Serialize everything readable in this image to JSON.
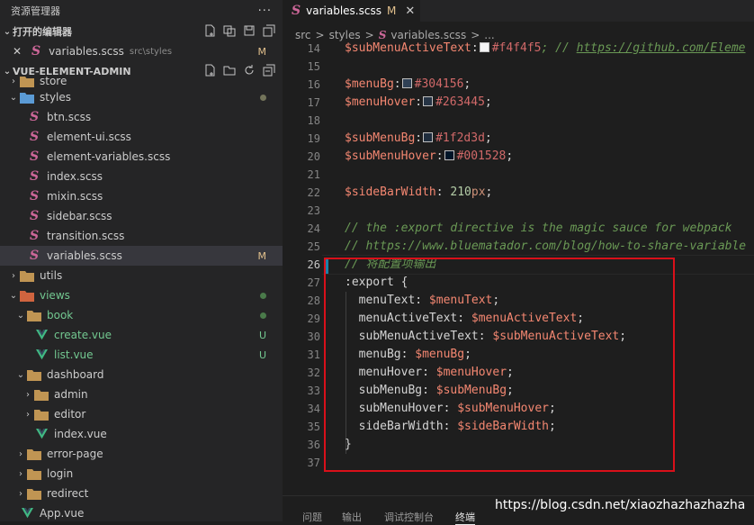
{
  "explorer": {
    "title": "资源管理器",
    "more": "···",
    "open_editors_label": "打开的编辑器",
    "open_file": {
      "close": "✕",
      "name": "variables.scss",
      "path": "src\\styles",
      "status": "M"
    },
    "project_label": "VUE-ELEMENT-ADMIN",
    "tree": [
      {
        "label": "store",
        "depth": 1,
        "type": "folder",
        "partial": true
      },
      {
        "label": "styles",
        "depth": 1,
        "type": "folder-open",
        "dot": true
      },
      {
        "label": "btn.scss",
        "depth": 2,
        "type": "scss"
      },
      {
        "label": "element-ui.scss",
        "depth": 2,
        "type": "scss"
      },
      {
        "label": "element-variables.scss",
        "depth": 2,
        "type": "scss"
      },
      {
        "label": "index.scss",
        "depth": 2,
        "type": "scss"
      },
      {
        "label": "mixin.scss",
        "depth": 2,
        "type": "scss"
      },
      {
        "label": "sidebar.scss",
        "depth": 2,
        "type": "scss"
      },
      {
        "label": "transition.scss",
        "depth": 2,
        "type": "scss"
      },
      {
        "label": "variables.scss",
        "depth": 2,
        "type": "scss",
        "status": "M",
        "selected": true
      },
      {
        "label": "utils",
        "depth": 1,
        "type": "folder"
      },
      {
        "label": "views",
        "depth": 1,
        "type": "folder-open",
        "dot": true,
        "green": true
      },
      {
        "label": "book",
        "depth": 2,
        "type": "folder-open",
        "dot": true,
        "green": true
      },
      {
        "label": "create.vue",
        "depth": 3,
        "type": "vue",
        "status": "U",
        "green": true
      },
      {
        "label": "list.vue",
        "depth": 3,
        "type": "vue",
        "status": "U",
        "green": true
      },
      {
        "label": "dashboard",
        "depth": 2,
        "type": "folder-open"
      },
      {
        "label": "admin",
        "depth": 3,
        "type": "folder"
      },
      {
        "label": "editor",
        "depth": 3,
        "type": "folder"
      },
      {
        "label": "index.vue",
        "depth": 3,
        "type": "vue"
      },
      {
        "label": "error-page",
        "depth": 2,
        "type": "folder"
      },
      {
        "label": "login",
        "depth": 2,
        "type": "folder"
      },
      {
        "label": "redirect",
        "depth": 2,
        "type": "folder"
      },
      {
        "label": "App.vue",
        "depth": 1,
        "type": "vue"
      }
    ]
  },
  "tab": {
    "name": "variables.scss",
    "status": "M",
    "close": "✕"
  },
  "breadcrumb": {
    "src": "src",
    "sep": ">",
    "styles": "styles",
    "file": "variables.scss",
    "more": "..."
  },
  "editor": {
    "line_numbers": [
      "14",
      "15",
      "16",
      "17",
      "18",
      "19",
      "20",
      "21",
      "22",
      "23",
      "24",
      "25",
      "26",
      "27",
      "28",
      "29",
      "30",
      "31",
      "32",
      "33",
      "34",
      "35",
      "36",
      "37"
    ],
    "current_line": "26",
    "line14": {
      "var": "$subMenuActiveText",
      "val": "#f4f4f5",
      "sep": "; // ",
      "url": "https://github.com/Eleme"
    },
    "line16": {
      "var": "$menuBg",
      "val": "#304156",
      "color": "#304156"
    },
    "line17": {
      "var": "$menuHover",
      "val": "#263445",
      "color": "#263445"
    },
    "line19": {
      "var": "$subMenuBg",
      "val": "#1f2d3d",
      "color": "#1f2d3d"
    },
    "line20": {
      "var": "$subMenuHover",
      "val": "#001528",
      "color": "#001528"
    },
    "line22": {
      "var": "$sideBarWidth",
      "num": "210",
      "unit": "px"
    },
    "line24": "// the :export directive is the magic sauce for webpack",
    "line25": "// https://www.bluematador.com/blog/how-to-share-variable",
    "line26": "// 将配置项输出",
    "line27": ":export {",
    "exports": [
      {
        "key": "menuText",
        "var": "$menuText"
      },
      {
        "key": "menuActiveText",
        "var": "$menuActiveText"
      },
      {
        "key": "subMenuActiveText",
        "var": "$subMenuActiveText"
      },
      {
        "key": "menuBg",
        "var": "$menuBg"
      },
      {
        "key": "menuHover",
        "var": "$menuHover"
      },
      {
        "key": "subMenuBg",
        "var": "$subMenuBg"
      },
      {
        "key": "subMenuHover",
        "var": "$subMenuHover"
      },
      {
        "key": "sideBarWidth",
        "var": "$sideBarWidth"
      }
    ],
    "line36": "}"
  },
  "panel": {
    "tabs": [
      "问题",
      "输出",
      "调试控制台",
      "终端"
    ],
    "active": "终端"
  },
  "watermark": "https://blog.csdn.net/xiaozhazhazhazha"
}
